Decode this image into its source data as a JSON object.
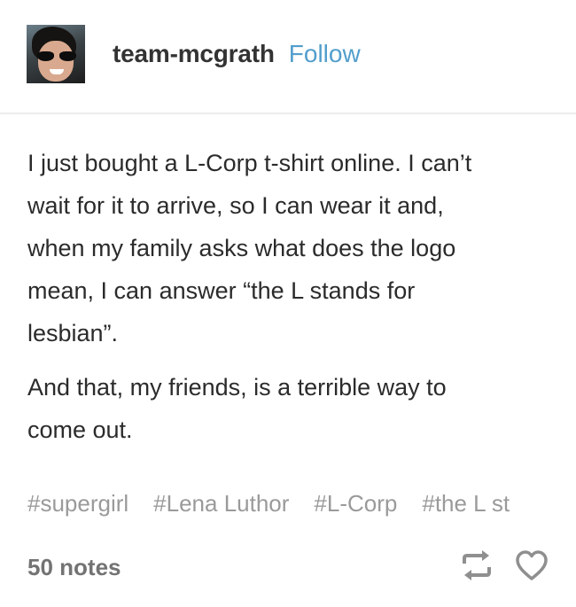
{
  "header": {
    "username": "team-mcgrath",
    "follow_label": "Follow"
  },
  "post": {
    "paragraph1_lines": [
      "I just bought a L-Corp t-shirt online. I can’t",
      "wait for it to arrive, so I can wear it and,",
      "when my family asks what does the logo",
      "mean, I can answer “the L stands for",
      "lesbian”."
    ],
    "paragraph2_lines": [
      "And that, my friends, is a terrible way to",
      "come out."
    ]
  },
  "tags": [
    "#supergirl",
    "#Lena Luthor",
    "#L-Corp",
    "#the L st"
  ],
  "footer": {
    "notes": "50 notes",
    "reblog_icon": "reblog-icon",
    "like_icon": "heart-icon"
  },
  "colors": {
    "link_blue": "#529ecc",
    "tag_gray": "#9a9a9a",
    "notes_gray": "#737373"
  }
}
